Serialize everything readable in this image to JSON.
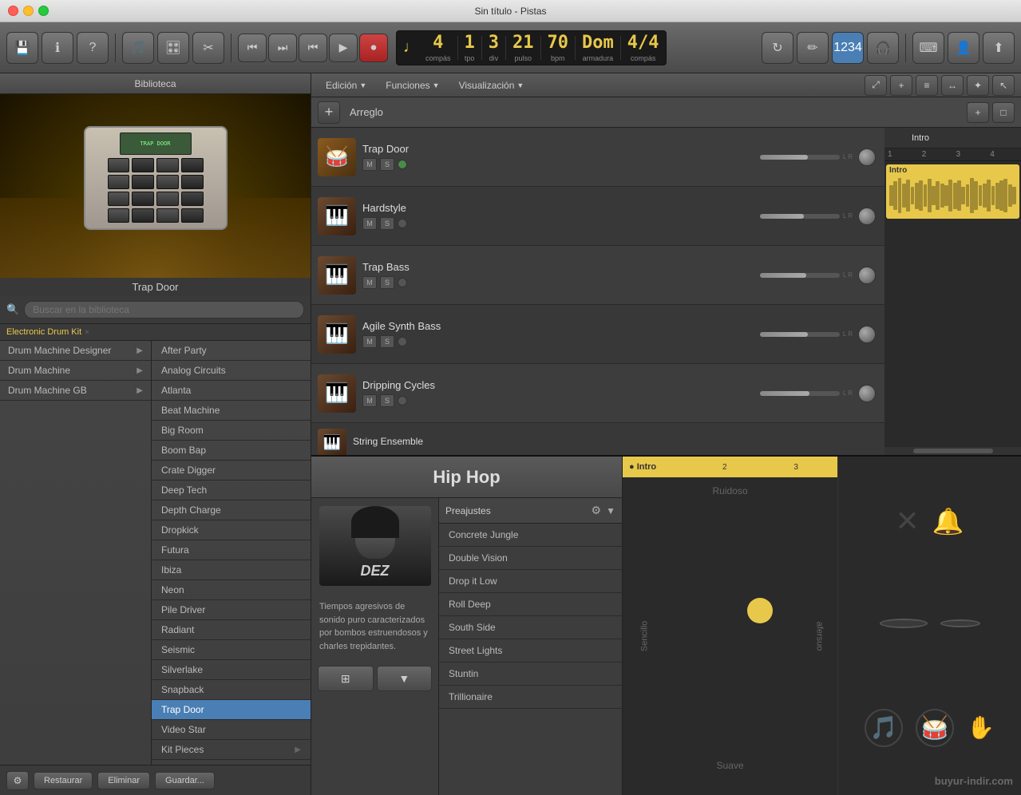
{
  "titlebar": {
    "title": "Sin título - Pistas"
  },
  "toolbar": {
    "display": {
      "compas": "4",
      "tpo": "1",
      "div": "3",
      "pulso": "21",
      "bpm": "70",
      "key": "Dom",
      "armadura": "M",
      "compas2": "4/4"
    },
    "compas_label": "compás",
    "tpo_label": "tpo",
    "div_label": "div",
    "pulso_label": "pulso",
    "bpm_label": "bpm",
    "armadura_label": "armadura",
    "compas2_label": "compás"
  },
  "library": {
    "header": "Biblioteca",
    "instrument_label": "Trap Door",
    "search_placeholder": "Buscar en la biblioteca",
    "breadcrumb": "Electronic Drum Kit",
    "categories": [
      {
        "label": "Drum Machine Designer",
        "has_arrow": true,
        "selected": false
      },
      {
        "label": "Drum Machine",
        "has_arrow": true,
        "selected": false
      },
      {
        "label": "Drum Machine GB",
        "has_arrow": true,
        "selected": false
      }
    ],
    "presets": [
      "After Party",
      "Analog Circuits",
      "Atlanta",
      "Beat Machine",
      "Big Room",
      "Boom Bap",
      "Crate Digger",
      "Deep Tech",
      "Depth Charge",
      "Dropkick",
      "Futura",
      "Ibiza",
      "Neon",
      "Pile Driver",
      "Radiant",
      "Seismic",
      "Silverlake",
      "Snapback",
      "Trap Door",
      "Video Star",
      "Kit Pieces"
    ],
    "footer": {
      "settings_label": "⚙",
      "restore_label": "Restaurar",
      "delete_label": "Eliminar",
      "save_label": "Guardar..."
    }
  },
  "tracks_area": {
    "menus": [
      "Edición",
      "Funciones",
      "Visualización"
    ],
    "arreglo_label": "Arreglo",
    "tracks": [
      {
        "name": "Trap Door",
        "icon_type": "drum"
      },
      {
        "name": "Hardstyle",
        "icon_type": "synth"
      },
      {
        "name": "Trap Bass",
        "icon_type": "synth"
      },
      {
        "name": "Agile Synth Bass",
        "icon_type": "synth"
      },
      {
        "name": "Dripping Cycles",
        "icon_type": "synth"
      },
      {
        "name": "String Ensemble",
        "icon_type": "synth"
      }
    ],
    "timeline": {
      "intro_label": "Intro",
      "region_label": "Intro",
      "ruler_marks": [
        "1",
        "2",
        "3",
        "4"
      ]
    }
  },
  "hiphop": {
    "label": "Hip Hop",
    "presets_label": "Preajustes",
    "artist_name": "DEZ",
    "description": "Tiempos agresivos de sonido puro caracterizados por bombos estruendosos y charles trepidantes.",
    "presets": [
      "Concrete Jungle",
      "Double Vision",
      "Drop it Low",
      "Roll Deep",
      "South Side",
      "Street Lights",
      "Stuntin",
      "Trillionaire"
    ]
  },
  "drum_pad": {
    "ruidoso_label": "Ruidoso",
    "suave_label": "Suave",
    "sencillo_label": "Sencillo",
    "afersuo_label": "afersuo",
    "bottom_timeline_label": "Intro",
    "ruler_marks": [
      "",
      "2",
      "",
      "3"
    ]
  },
  "watermark": "buyur-indir.com"
}
